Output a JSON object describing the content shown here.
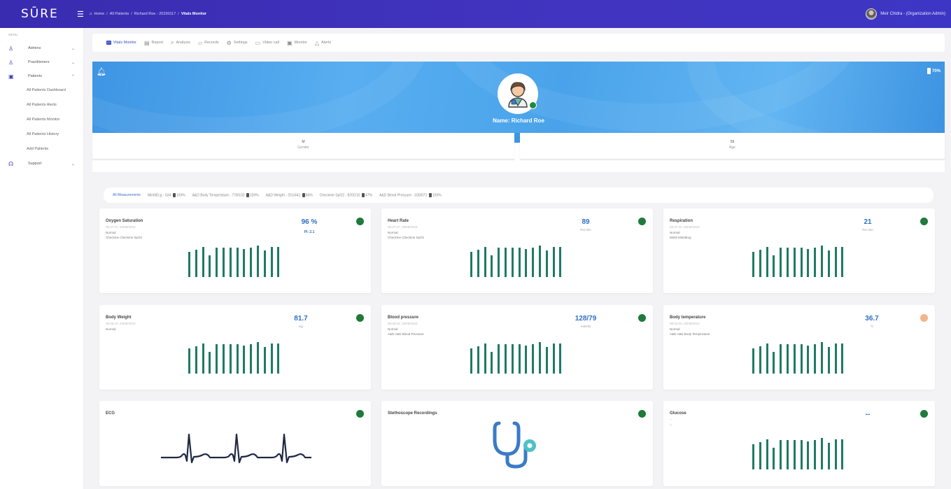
{
  "app": {
    "logo": "SŪRE"
  },
  "breadcrumb": {
    "home": "Home",
    "items": [
      "All Patients",
      "Richard Roe - 20230117"
    ],
    "current": "Vitals Monitor"
  },
  "user": {
    "name": "Meir Chidra - (Organization Admin)"
  },
  "sidebar": {
    "menu_label": "MENU",
    "items": [
      {
        "label": "Admins",
        "icon": "user-icon",
        "chevron": "⌄"
      },
      {
        "label": "Practitioners",
        "icon": "user-icon",
        "chevron": "⌄"
      },
      {
        "label": "Patients",
        "icon": "patient-icon",
        "chevron": "⌃"
      }
    ],
    "subitems": [
      "All Patients Dashboard",
      "All Patients Alerts",
      "All Patients Monitor",
      "All Patients History",
      "Add Patients"
    ],
    "support": {
      "label": "Support",
      "icon": "headset-icon",
      "chevron": "⌄"
    }
  },
  "tabs": [
    {
      "label": "Vitals Monitor",
      "icon": "monitor-icon",
      "active": true
    },
    {
      "label": "Report",
      "icon": "report-icon"
    },
    {
      "label": "Analysis",
      "icon": "analysis-icon"
    },
    {
      "label": "Records",
      "icon": "folder-icon"
    },
    {
      "label": "Settings",
      "icon": "gear-icon"
    },
    {
      "label": "Video call",
      "icon": "video-icon"
    },
    {
      "label": "Monitor",
      "icon": "screen-icon"
    },
    {
      "label": "Alerts",
      "icon": "bell-icon"
    }
  ],
  "banner": {
    "battery": "70%",
    "name": "Name: Richard Roe",
    "colors": {
      "blue": "#4aa0e8",
      "online": "#1f8a3b"
    }
  },
  "info": {
    "gender": {
      "value": "M",
      "label": "Gender"
    },
    "age": {
      "value": "59",
      "label": "Age"
    }
  },
  "filters": [
    {
      "label": "All Measurements",
      "active": true
    },
    {
      "label": "MinttiEcg - 534",
      "battery": "100%"
    },
    {
      "label": "A&D Body Temperature - 778/102",
      "battery": "100%"
    },
    {
      "label": "A&D Weight - 251/441",
      "battery": "66%"
    },
    {
      "label": "Checkme SpO2 - 820/215",
      "battery": "47%"
    },
    {
      "label": "A&D Blood Pressure - 330/071",
      "battery": "100%"
    }
  ],
  "cards": [
    {
      "title": "Oxygen Saturation",
      "ts": "08:37:37, 03/08/2023",
      "status": "Normal",
      "device": "Checkme Checkme SpO2",
      "value": "96 %",
      "extra": "PI: 2.1",
      "unit": "",
      "dot": "#1f7a3b"
    },
    {
      "title": "Heart Rate",
      "ts": "08:37:37, 03/08/2023",
      "status": "Normal",
      "device": "Checkme Checkme SpO2",
      "value": "89",
      "unit": "Per min",
      "dot": "#1f7a3b"
    },
    {
      "title": "Respiration",
      "ts": "08:37:32, 03/08/2023",
      "status": "Normal",
      "device": "Mintti MinttiEcg",
      "value": "21",
      "unit": "Per min",
      "dot": "#1f7a3b"
    },
    {
      "title": "Body Weight",
      "ts": "08:35:43, 03/08/2023",
      "status": "Normal",
      "device": "",
      "value": "81.7",
      "unit": "Kg",
      "dot": "#1f7a3b"
    },
    {
      "title": "Blood pressure",
      "ts": "08:35:03, 03/08/2023",
      "status": "Normal",
      "device": "A&D A&D Blood Pressure",
      "value": "128/79",
      "unit": "mmHG",
      "dot": "#1f7a3b"
    },
    {
      "title": "Body temperature",
      "ts": "08:34:03, 03/08/2023",
      "status": "Normal",
      "device": "A&D A&D Body Temperature",
      "value": "36.7",
      "unit": "°C",
      "dot": "#f2b48a"
    },
    {
      "title": "ECG",
      "dot": "#1f7a3b"
    },
    {
      "title": "Stethoscope Recordings",
      "dot": "#1f7a3b"
    },
    {
      "title": "Glucose",
      "ts": "--",
      "status": "--",
      "value": "--",
      "dot": "#1f7a3b"
    }
  ]
}
